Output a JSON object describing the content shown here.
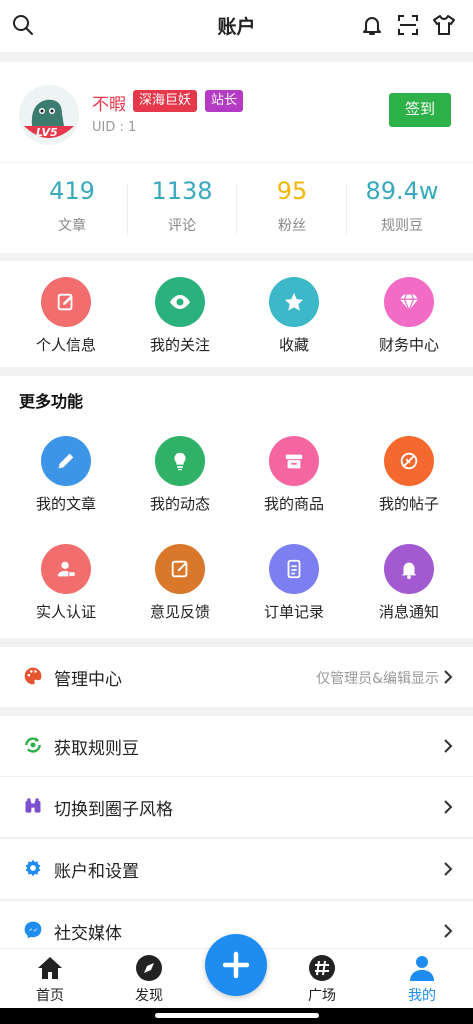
{
  "header": {
    "title": "账户"
  },
  "profile": {
    "name": "不暇",
    "badges": [
      "深海巨妖",
      "站长"
    ],
    "uid": "UID : 1",
    "level": "LV5",
    "signin_label": "签到"
  },
  "stats": [
    {
      "value": "419",
      "label": "文章"
    },
    {
      "value": "1138",
      "label": "评论"
    },
    {
      "value": "95",
      "label": "粉丝"
    },
    {
      "value": "89.4w",
      "label": "规则豆"
    }
  ],
  "quick": [
    {
      "label": "个人信息",
      "icon": "edit-icon",
      "color": "#f26d6d"
    },
    {
      "label": "我的关注",
      "icon": "eye-icon",
      "color": "#2bb17b"
    },
    {
      "label": "收藏",
      "icon": "star-icon",
      "color": "#3db8c9"
    },
    {
      "label": "财务中心",
      "icon": "diamond-icon",
      "color": "#f26bc4"
    }
  ],
  "more": {
    "title": "更多功能",
    "items": [
      {
        "label": "我的文章",
        "icon": "pencil-icon",
        "color": "#3d95e8"
      },
      {
        "label": "我的动态",
        "icon": "bulb-icon",
        "color": "#2fb167"
      },
      {
        "label": "我的商品",
        "icon": "shop-icon",
        "color": "#f565a2"
      },
      {
        "label": "我的帖子",
        "icon": "forum-icon",
        "color": "#f5692f"
      },
      {
        "label": "实人认证",
        "icon": "id-user-icon",
        "color": "#f26d6d"
      },
      {
        "label": "意见反馈",
        "icon": "feedback-icon",
        "color": "#d9782a"
      },
      {
        "label": "订单记录",
        "icon": "receipt-icon",
        "color": "#7b7ff0"
      },
      {
        "label": "消息通知",
        "icon": "bell-icon",
        "color": "#a35ad1"
      }
    ]
  },
  "menu": [
    {
      "label": "管理中心",
      "note": "仅管理员&编辑显示",
      "icon": "palette-icon",
      "color": "#e5532f"
    },
    {
      "label": "获取规则豆",
      "note": "",
      "icon": "refresh-coin-icon",
      "color": "#2fb14a"
    },
    {
      "label": "切换到圈子风格",
      "note": "",
      "icon": "binoculars-icon",
      "color": "#7b4fd0"
    },
    {
      "label": "账户和设置",
      "note": "",
      "icon": "gear-icon",
      "color": "#1e8cf0"
    },
    {
      "label": "社交媒体",
      "note": "",
      "icon": "messenger-icon",
      "color": "#1e8cf0"
    }
  ],
  "tabs": [
    {
      "label": "首页",
      "icon": "home-icon"
    },
    {
      "label": "发现",
      "icon": "compass-icon"
    },
    {
      "label": "广场",
      "icon": "hashtag-icon"
    },
    {
      "label": "我的",
      "icon": "user-icon"
    }
  ],
  "colors": {
    "accent": "#1e8cf0",
    "active_tab": "#1e8cf0",
    "stat_value": "#3aa9bd",
    "fans_value": "#f2b705",
    "signin": "#2fb14a"
  }
}
